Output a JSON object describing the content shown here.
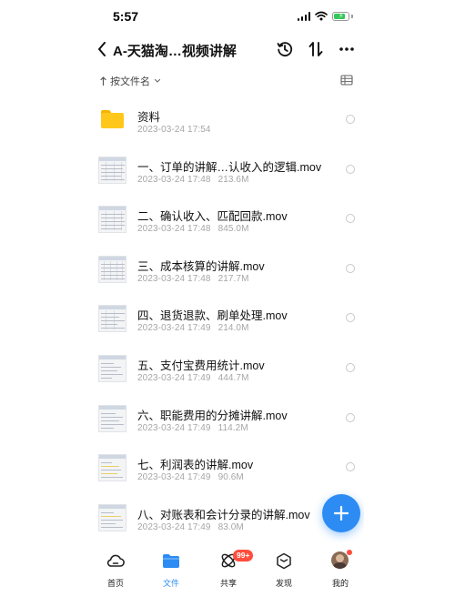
{
  "status_bar": {
    "time": "5:57"
  },
  "nav": {
    "title": "A-天猫淘…视频讲解"
  },
  "sort": {
    "label": "按文件名"
  },
  "files": [
    {
      "name": "资料",
      "date": "2023-03-24 17:54",
      "size": "",
      "type": "folder"
    },
    {
      "name": "一、订单的讲解…认收入的逻辑.mov",
      "date": "2023-03-24 17:48",
      "size": "213.6M",
      "type": "video"
    },
    {
      "name": "二、确认收入、匹配回款.mov",
      "date": "2023-03-24 17:48",
      "size": "845.0M",
      "type": "video"
    },
    {
      "name": "三、成本核算的讲解.mov",
      "date": "2023-03-24 17:48",
      "size": "217.7M",
      "type": "video"
    },
    {
      "name": "四、退货退款、刷单处理.mov",
      "date": "2023-03-24 17:49",
      "size": "214.0M",
      "type": "video"
    },
    {
      "name": "五、支付宝费用统计.mov",
      "date": "2023-03-24 17:49",
      "size": "444.7M",
      "type": "video"
    },
    {
      "name": "六、职能费用的分摊讲解.mov",
      "date": "2023-03-24 17:49",
      "size": "114.2M",
      "type": "video"
    },
    {
      "name": "七、利润表的讲解.mov",
      "date": "2023-03-24 17:49",
      "size": "90.6M",
      "type": "video"
    },
    {
      "name": "八、对账表和会计分录的讲解.mov",
      "date": "2023-03-24 17:49",
      "size": "83.0M",
      "type": "video"
    }
  ],
  "tabbar": {
    "home": "首页",
    "files": "文件",
    "share": "共享",
    "discover": "发现",
    "mine": "我的",
    "share_badge": "99+"
  },
  "colors": {
    "accent": "#2c8cf4",
    "folder": "#ffc71a",
    "badge": "#ff4d3d",
    "meta_text": "#a6a6a6"
  },
  "icons": {
    "back": "chevron-left-icon",
    "history": "history-icon",
    "sort": "sort-arrows-icon",
    "more": "more-dots-icon",
    "fab": "plus-icon"
  }
}
